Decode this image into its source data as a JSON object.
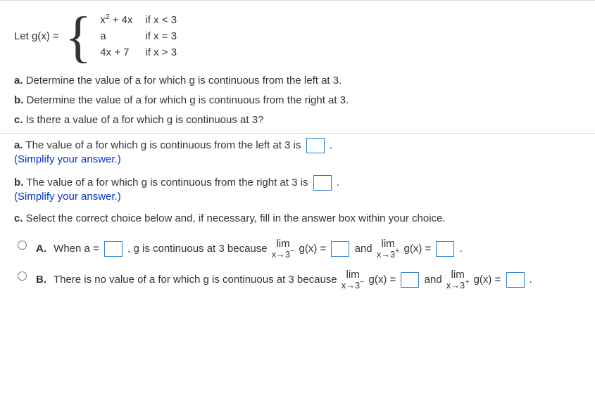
{
  "fn": {
    "lhs": "Let g(x) =",
    "row1_expr": "x² + 4x",
    "row1_cond": "if x < 3",
    "row2_expr": "a",
    "row2_cond": "if x = 3",
    "row3_expr": "4x + 7",
    "row3_cond": "if x > 3"
  },
  "prompts": {
    "a": "a. Determine the value of a for which g is continuous from the left at 3.",
    "b": "b. Determine the value of a for which g is continuous from the right at 3.",
    "c": "c. Is there a value of a for which g is continuous at 3?"
  },
  "ans_a": {
    "text_before": "a. The value of a for which g is continuous from the left at 3 is ",
    "text_after": ".",
    "hint": "(Simplify your answer.)"
  },
  "ans_b": {
    "text_before": "b. The value of a for which g is continuous from the right at 3 is ",
    "text_after": ".",
    "hint": "(Simplify your answer.)"
  },
  "ans_c_intro": "c. Select the correct choice below and, if necessary, fill in the answer box within your choice.",
  "choiceA": {
    "label": "A.",
    "p1": "When a = ",
    "p2": ", g is continuous at 3 because ",
    "lim1_top": "lim",
    "lim1_bot": "x→3",
    "p3": " g(x) = ",
    "p4": " and ",
    "lim2_top": "lim",
    "lim2_bot": "x→3",
    "p5": " g(x) = ",
    "p6": "."
  },
  "choiceB": {
    "label": "B.",
    "p1": "There is no value of a for which g is continuous at 3 because ",
    "lim1_top": "lim",
    "lim1_bot": "x→3",
    "p2": " g(x) = ",
    "p3": " and ",
    "lim2_top": "lim",
    "lim2_bot": "x→3",
    "p4": " g(x) = ",
    "p5": "."
  }
}
